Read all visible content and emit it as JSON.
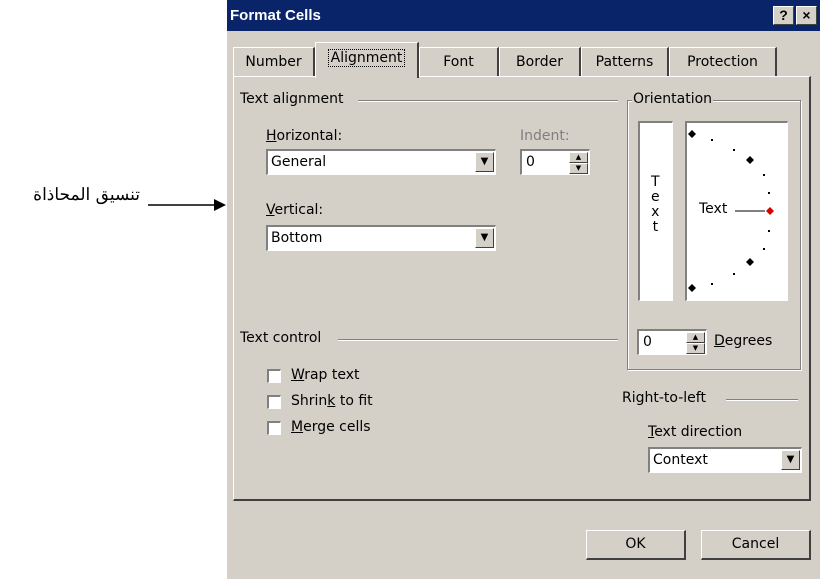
{
  "annotation": {
    "text": "تنسيق المحاذاة"
  },
  "dialog": {
    "title": "Format Cells",
    "help_label": "?",
    "close_label": "×",
    "tabs": [
      {
        "label": "Number"
      },
      {
        "label": "Alignment",
        "active": true
      },
      {
        "label": "Font"
      },
      {
        "label": "Border"
      },
      {
        "label": "Patterns"
      },
      {
        "label": "Protection"
      }
    ]
  },
  "text_alignment": {
    "heading": "Text alignment",
    "horizontal_label": "orizontal:",
    "horizontal_accel": "H",
    "horizontal_value": "General",
    "indent_label": "Indent:",
    "indent_value": "0",
    "vertical_label": "ertical:",
    "vertical_accel": "V",
    "vertical_value": "Bottom"
  },
  "orientation": {
    "heading": "Orientation",
    "vertical_text": [
      "T",
      "e",
      "x",
      "t"
    ],
    "dial_text": "Text",
    "degrees_value": "0",
    "degrees_label": "egrees",
    "degrees_accel": "D"
  },
  "text_control": {
    "heading": "Text control",
    "wrap_accel": "W",
    "wrap_rest": "rap text",
    "shrink_pre": "Shrin",
    "shrink_accel": "k",
    "shrink_rest": " to fit",
    "merge_accel": "M",
    "merge_rest": "erge cells",
    "wrap_checked": false,
    "shrink_checked": false,
    "merge_checked": false
  },
  "rtl": {
    "heading": "Right-to-left",
    "direction_accel": "T",
    "direction_rest": "ext direction",
    "direction_value": "Context"
  },
  "buttons": {
    "ok": "OK",
    "cancel": "Cancel"
  },
  "colors": {
    "titlebar": "#0a246a",
    "face": "#d4d0c8",
    "dial_marker": "#d40000"
  }
}
